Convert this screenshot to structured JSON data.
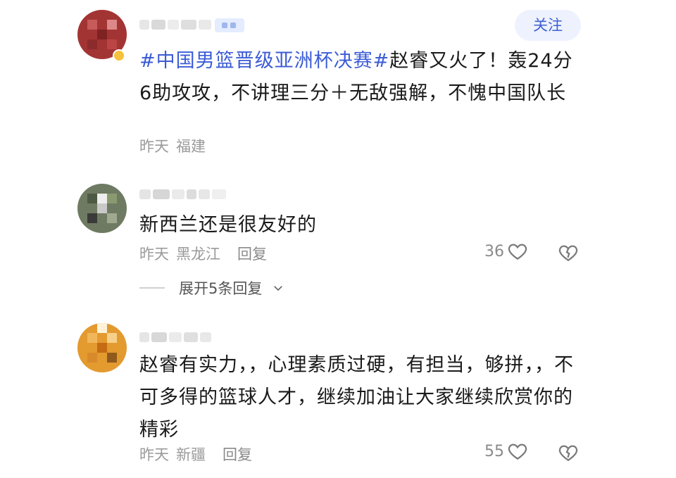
{
  "comments": [
    {
      "text_hashtag": "#中国男篮晋级亚洲杯决赛#",
      "text_body": "赵睿又火了！轰24分6助攻攻，不讲理三分＋无敌强解，不愧中国队长",
      "time": "昨天",
      "location": "福建",
      "follow_label": "关注"
    },
    {
      "text_body": "新西兰还是很友好的",
      "time": "昨天",
      "location": "黑龙江",
      "reply_label": "回复",
      "likes": "36",
      "expand_label": "展开5条回复"
    },
    {
      "text_body": "赵睿有实力，，心理素质过硬，有担当，够拼，，不可多得的篮球人才，继续加油让大家继续欣赏你的精彩",
      "time": "昨天",
      "location": "新疆",
      "reply_label": "回复",
      "likes": "55"
    }
  ],
  "colors": {
    "accent": "#3b5bd6",
    "follow_bg": "#eef2ff",
    "meta": "#9a9a9a"
  },
  "icons": [
    "heart-icon",
    "broken-heart-icon",
    "chevron-down-icon"
  ]
}
